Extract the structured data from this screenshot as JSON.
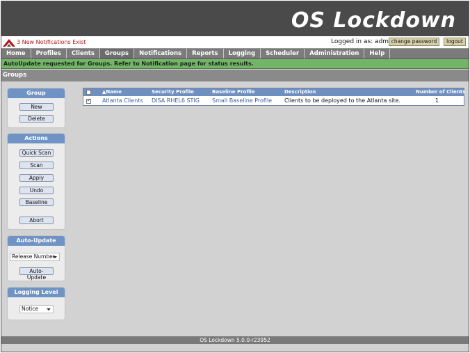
{
  "banner": {
    "title": "OS Lockdown"
  },
  "header": {
    "notifications_text": "3 New Notifications Exist",
    "logged_in_text": "Logged in as: admin",
    "change_password_label": "change password",
    "logout_label": "logout"
  },
  "nav": {
    "items": [
      {
        "label": "Home"
      },
      {
        "label": "Profiles"
      },
      {
        "label": "Clients"
      },
      {
        "label": "Groups"
      },
      {
        "label": "Notifications"
      },
      {
        "label": "Reports"
      },
      {
        "label": "Logging"
      },
      {
        "label": "Scheduler"
      },
      {
        "label": "Administration"
      },
      {
        "label": "Help"
      }
    ],
    "active": "Groups"
  },
  "message": {
    "text": "AutoUpdate requested for Groups. Refer to Notification page for status results."
  },
  "page": {
    "title": "Groups"
  },
  "sidebar": {
    "group": {
      "title": "Group",
      "new_label": "New",
      "delete_label": "Delete"
    },
    "actions": {
      "title": "Actions",
      "quick_scan_label": "Quick Scan",
      "scan_label": "Scan",
      "apply_label": "Apply",
      "undo_label": "Undo",
      "baseline_label": "Baseline",
      "abort_label": "Abort"
    },
    "auto_update": {
      "title": "Auto-Update",
      "select_value": "Release Number",
      "button_label": "Auto-Update"
    },
    "logging_level": {
      "title": "Logging Level",
      "select_value": "Notice"
    }
  },
  "table": {
    "columns": {
      "name": "▲Name",
      "security_profile": "Security Profile",
      "baseline_profile": "Baseline Profile",
      "description": "Description",
      "num_clients": "Number of Clients"
    },
    "rows": [
      {
        "checked": true,
        "name": "Atlanta Clients",
        "security_profile": "DISA RHEL6 STIG",
        "baseline_profile": "Small Baseline Profile",
        "description": "Clients to be deployed to the Atlanta site.",
        "num_clients": "1"
      }
    ]
  },
  "footer": {
    "text": "OS Lockdown 5.0.0-r23952"
  },
  "colors": {
    "banner": "#4a4a4a",
    "nav": "#7b7b7b",
    "message": "#76b36a",
    "panel_header": "#6e93c4",
    "notification_link": "#b01818"
  }
}
